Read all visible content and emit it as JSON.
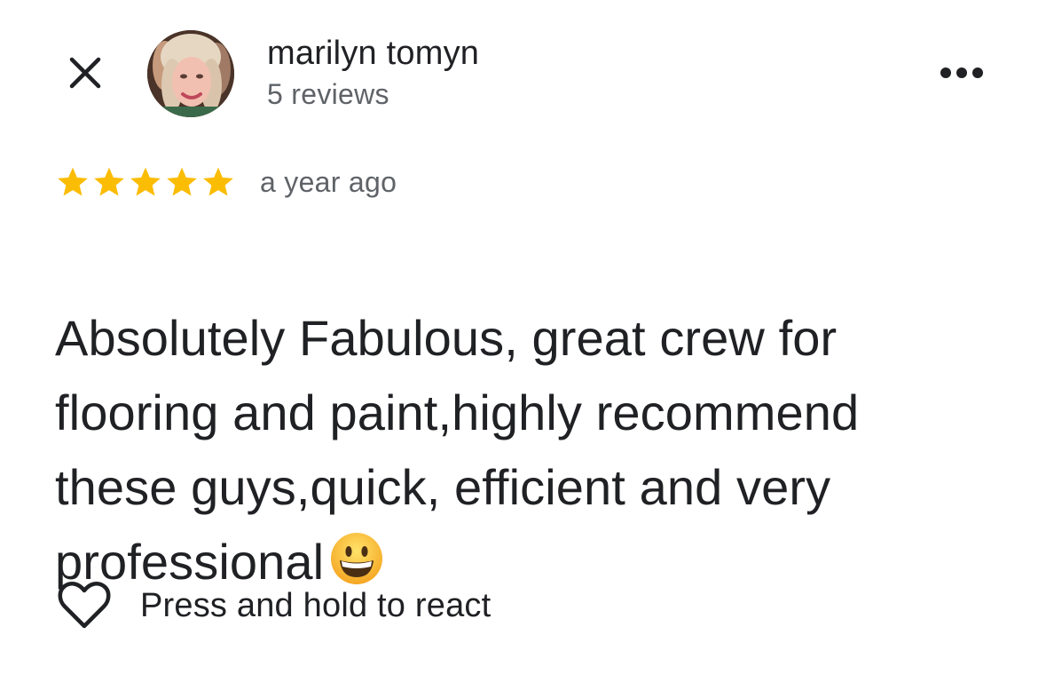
{
  "header": {
    "close_icon": "close-icon",
    "author_name": "marilyn tomyn",
    "author_reviews": "5 reviews",
    "more_icon": "more-horizontal-icon"
  },
  "review": {
    "rating": 5,
    "max_rating": 5,
    "star_color": "#fbbc04",
    "time": "a year ago",
    "lines": [
      "Absolutely Fabulous, great crew for",
      "flooring and paint,highly recommend",
      "these guys,quick, efficient and very",
      "professional"
    ],
    "emoji": "grinning-face-emoji"
  },
  "footer": {
    "react_icon": "heart-outline-icon",
    "react_label": "Press and hold to react"
  }
}
